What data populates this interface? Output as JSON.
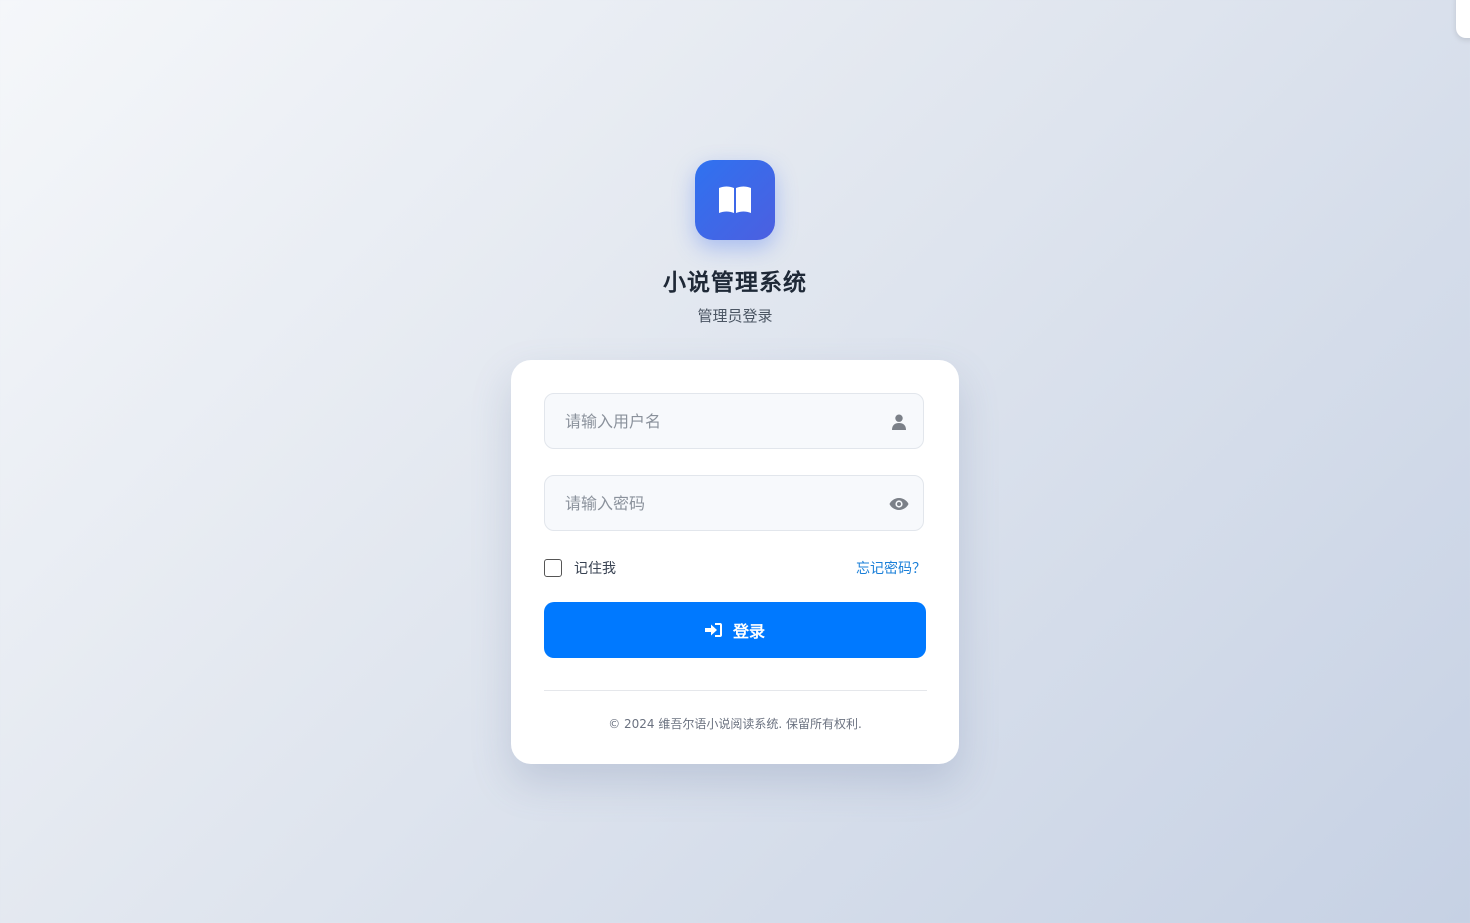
{
  "header": {
    "app_title": "小说管理系统",
    "subtitle": "管理员登录",
    "logo_icon": "open-book-icon"
  },
  "form": {
    "username": {
      "value": "",
      "placeholder": "请输入用户名",
      "icon": "user-icon"
    },
    "password": {
      "value": "",
      "placeholder": "请输入密码",
      "icon": "eye-icon"
    },
    "remember_label": "记住我",
    "remember_checked": false,
    "forgot_link": "忘记密码？",
    "login_label": "登录",
    "login_icon": "sign-in-icon"
  },
  "footer": {
    "copyright": "© 2024 维吾尔语小说阅读系统. 保留所有权利."
  },
  "colors": {
    "accent": "#0079ff",
    "logo_gradient_start": "#2f72f0",
    "logo_gradient_end": "#4c5fe0",
    "link": "#1a7fd8",
    "title": "#1f2937"
  }
}
